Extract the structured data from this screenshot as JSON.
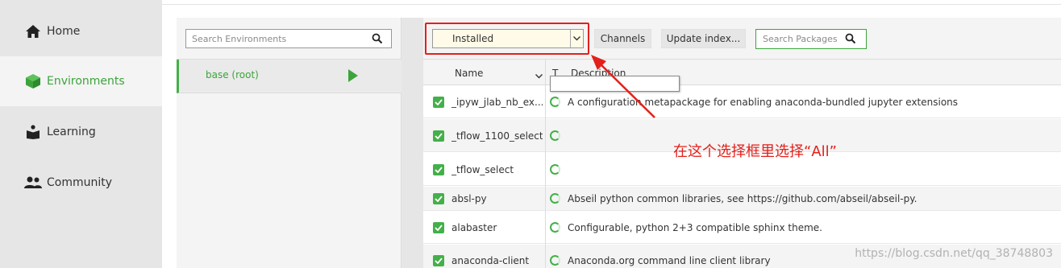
{
  "nav": {
    "items": [
      {
        "label": "Home",
        "icon": "home-icon",
        "active": false
      },
      {
        "label": "Environments",
        "icon": "cube-icon",
        "active": true
      },
      {
        "label": "Learning",
        "icon": "book-icon",
        "active": false
      },
      {
        "label": "Community",
        "icon": "people-icon",
        "active": false
      }
    ]
  },
  "environments": {
    "search_placeholder": "Search Environments",
    "items": [
      {
        "name": "base (root)",
        "selected": true
      }
    ]
  },
  "packages": {
    "filter_value": "Installed",
    "channels_label": "Channels",
    "update_index_label": "Update index...",
    "search_placeholder": "Search Packages",
    "columns": {
      "name": "Name",
      "type": "T",
      "description": "Description"
    },
    "rows": [
      {
        "name": "_ipyw_jlab_nb_ex...",
        "description": "A configuration metapackage for enabling anaconda-bundled jupyter extensions",
        "checked": true
      },
      {
        "name": "_tflow_1100_select",
        "description": "",
        "checked": true
      },
      {
        "name": "_tflow_select",
        "description": "",
        "checked": true
      },
      {
        "name": "absl-py",
        "description": "Abseil python common libraries, see https://github.com/abseil/abseil-py.",
        "checked": true
      },
      {
        "name": "alabaster",
        "description": "Configurable, python 2+3 compatible sphinx theme.",
        "checked": true
      },
      {
        "name": "anaconda-client",
        "description": "Anaconda.org command line client library",
        "checked": true
      }
    ]
  },
  "annotation": {
    "text": "在这个选择框里选择“All”",
    "color": "#e3201b"
  },
  "watermark": "https://blog.csdn.net/qq_38748803",
  "colors": {
    "accent": "#43b049",
    "nav_bg": "#e6e6e6",
    "annotation": "#e3201b"
  }
}
